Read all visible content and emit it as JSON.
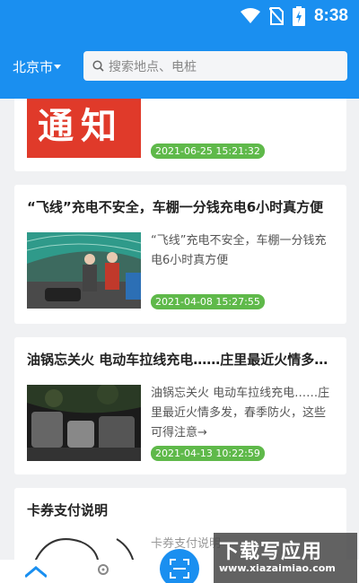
{
  "status_bar": {
    "time": "8:38",
    "icons": [
      "wifi-icon",
      "no-sim-icon",
      "battery-charging-icon"
    ]
  },
  "header": {
    "city": "北京市",
    "search_placeholder": "搜索地点、电桩"
  },
  "notices": [
    {
      "thumb_text": "通知",
      "date": "2021-06-25 15:21:32"
    },
    {
      "title": "“飞线”充电不安全，车棚一分钱充电6小时真方便",
      "excerpt_lines": [
        "“飞线”充电不安全，车棚一分钱充",
        "电6小时真方便"
      ],
      "date": "2021-04-08 15:27:55"
    },
    {
      "title": "油锅忘关火 电动车拉线充电……庄里最近火情多…",
      "excerpt_lines": [
        "油锅忘关火 电动车拉线充电……庄",
        "里最近火情多发，春季防火，这些",
        "可得注意→"
      ],
      "date": "2021-04-13 10:22:59"
    },
    {
      "title": "卡券支付说明",
      "excerpt_lines": [
        "卡券支付说明"
      ]
    }
  ],
  "bottom_nav": {
    "items": [
      "home-icon",
      "user-icon",
      "scan-icon"
    ]
  },
  "watermark": {
    "main": "下载写应用",
    "sub": "www.xiazaimiao.com"
  },
  "colors": {
    "accent": "#1a8ff0",
    "date_badge": "#5fb94a",
    "notice_red": "#e03a2a"
  }
}
